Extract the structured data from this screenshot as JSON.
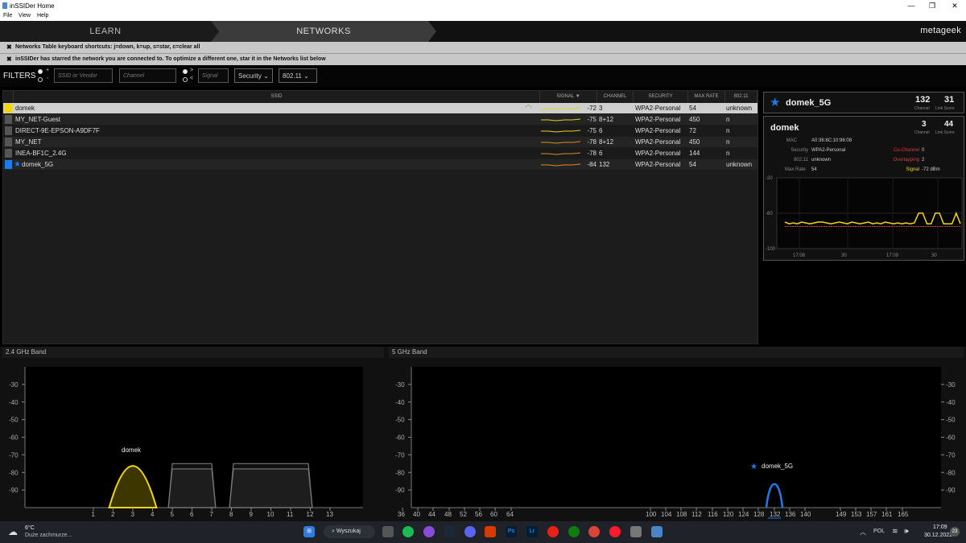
{
  "window": {
    "title": "inSSIDer Home",
    "minimize": "—",
    "maximize": "❐",
    "close": "✕"
  },
  "menu": [
    "File",
    "View",
    "Help"
  ],
  "nav": {
    "learn": "LEARN",
    "networks": "NETWORKS",
    "logo": "metageek"
  },
  "notices": {
    "shortcuts": "Networks Table keyboard shortcuts: j=down, k=up, s=star, c=clear all",
    "starred": "inSSIDer has starred the network you are connected to. To optimize a different one, star it in the Networks list below"
  },
  "filters": {
    "label": "FILTERS",
    "ssid_placeholder": "SSID or Vendor",
    "channel_placeholder": "Channel",
    "signal_placeholder": "Signal",
    "security": "Security",
    "dot11": "802.11",
    "plus": "+",
    "minus": "-",
    "gt": ">",
    "lt": "<"
  },
  "table": {
    "headers": {
      "ssid": "SSID",
      "signal": "SIGNAL ▼",
      "channel": "CHANNEL",
      "security": "SECURITY",
      "max_rate": "MAX RATE",
      "dot11": "802.11"
    },
    "rows": [
      {
        "ssid": "domek",
        "signal": "-72",
        "channel": "3",
        "security": "WPA2-Personal",
        "max_rate": "54",
        "dot11": "unknown",
        "color": "#f2d70f",
        "selected": true,
        "starred": false,
        "wifi": true,
        "trend": "#e3d01e"
      },
      {
        "ssid": "MY_NET-Guest",
        "signal": "-75",
        "channel": "8+12",
        "security": "WPA2-Personal",
        "max_rate": "450",
        "dot11": "n",
        "color": "#555555",
        "selected": false,
        "starred": false,
        "wifi": false,
        "trend": "#e3d01e"
      },
      {
        "ssid": "DIRECT-9E-EPSON-A9DF7F",
        "signal": "-75",
        "channel": "6",
        "security": "WPA2-Personal",
        "max_rate": "72",
        "dot11": "n",
        "color": "#555555",
        "selected": false,
        "starred": false,
        "wifi": false,
        "trend": "#e3d01e"
      },
      {
        "ssid": "MY_NET",
        "signal": "-78",
        "channel": "8+12",
        "security": "WPA2-Personal",
        "max_rate": "450",
        "dot11": "n",
        "color": "#555555",
        "selected": false,
        "starred": false,
        "wifi": false,
        "trend": "#e08a1e"
      },
      {
        "ssid": "INEA-BF1C_2.4G",
        "signal": "-78",
        "channel": "6",
        "security": "WPA2-Personal",
        "max_rate": "144",
        "dot11": "n",
        "color": "#555555",
        "selected": false,
        "starred": false,
        "wifi": false,
        "trend": "#e08a1e"
      },
      {
        "ssid": "domek_5G",
        "signal": "-84",
        "channel": "132",
        "security": "WPA2-Personal",
        "max_rate": "54",
        "dot11": "unknown",
        "color": "#1e7be8",
        "selected": false,
        "starred": true,
        "wifi": false,
        "trend": "#e08a1e"
      }
    ]
  },
  "starred_card": {
    "ssid": "domek_5G",
    "channel": "132",
    "channel_label": "Channel",
    "link_score": "31",
    "link_score_label": "Link Score"
  },
  "detail_card": {
    "ssid": "domek",
    "channel": "3",
    "channel_label": "Channel",
    "link_score": "44",
    "link_score_label": "Link Score",
    "mac_label": "MAC",
    "mac": "A0:36:8C:10:96:08",
    "security_label": "Security",
    "security": "WPA2-Personal",
    "dot11_label": "802.11",
    "dot11": "unknown",
    "maxrate_label": "Max Rate",
    "maxrate": "54",
    "cochannel_label": "Co-Channel",
    "cochannel": "0",
    "overlapping_label": "Overlapping",
    "overlapping": "2",
    "signal_label": "Signal",
    "signal": "-72 dBm",
    "graph": {
      "y_ticks": [
        "-20",
        "-60",
        "-100"
      ],
      "x_ticks": [
        "17:08",
        "30",
        "17:09",
        "30"
      ],
      "signal_series": [
        -70,
        -72,
        -71,
        -72,
        -70,
        -71,
        -72,
        -71,
        -70,
        -70,
        -71,
        -72,
        -71,
        -70,
        -71,
        -72,
        -70,
        -71,
        -72,
        -71,
        -70,
        -72,
        -71,
        -72,
        -70,
        -71,
        -72,
        -71,
        -72,
        -71,
        -72,
        -71,
        -60,
        -60,
        -72,
        -72,
        -60,
        -60,
        -72,
        -72,
        -72,
        -60,
        -72
      ],
      "threshold": -75
    }
  },
  "band24": {
    "title": "2.4 GHz Band",
    "y_ticks": [
      "-30",
      "-40",
      "-50",
      "-60",
      "-70",
      "-80",
      "-90"
    ],
    "x_ticks": [
      "1",
      "2",
      "3",
      "4",
      "5",
      "6",
      "7",
      "8",
      "9",
      "10",
      "11",
      "12",
      "13"
    ],
    "networks": [
      {
        "name": "domek",
        "channel": 3,
        "signal": -72,
        "width": 20,
        "color": "#f2d70f",
        "label": "domek"
      },
      {
        "name": "MY_NET-Guest",
        "channel": 10,
        "signal": -75,
        "width": 40,
        "color": "#777777",
        "label": ""
      },
      {
        "name": "DIRECT-9E-EPSON-A9DF7F",
        "channel": 6,
        "signal": -75,
        "width": 20,
        "color": "#777777",
        "label": ""
      },
      {
        "name": "MY_NET",
        "channel": 10,
        "signal": -78,
        "width": 40,
        "color": "#777777",
        "label": ""
      },
      {
        "name": "INEA-BF1C_2.4G",
        "channel": 6,
        "signal": -78,
        "width": 20,
        "color": "#777777",
        "label": ""
      }
    ]
  },
  "band5": {
    "title": "5 GHz Band",
    "y_ticks": [
      "-30",
      "-40",
      "-50",
      "-60",
      "-70",
      "-80",
      "-90"
    ],
    "x_ticks": [
      "36",
      "40",
      "44",
      "48",
      "52",
      "56",
      "60",
      "64",
      "100",
      "104",
      "108",
      "112",
      "116",
      "120",
      "124",
      "128",
      "132",
      "136",
      "140",
      "149",
      "153",
      "157",
      "161",
      "165"
    ],
    "network": {
      "name": "domek_5G",
      "channel": 132,
      "signal": -84,
      "color": "#1e7be8",
      "label": "domek_5G"
    }
  },
  "taskbar": {
    "weather_temp": "6°C",
    "weather_desc": "Duże zachmurze...",
    "search": "Wyszukaj",
    "lang": "POL",
    "time": "17:09",
    "date": "30.12.2022",
    "badge": "23"
  }
}
